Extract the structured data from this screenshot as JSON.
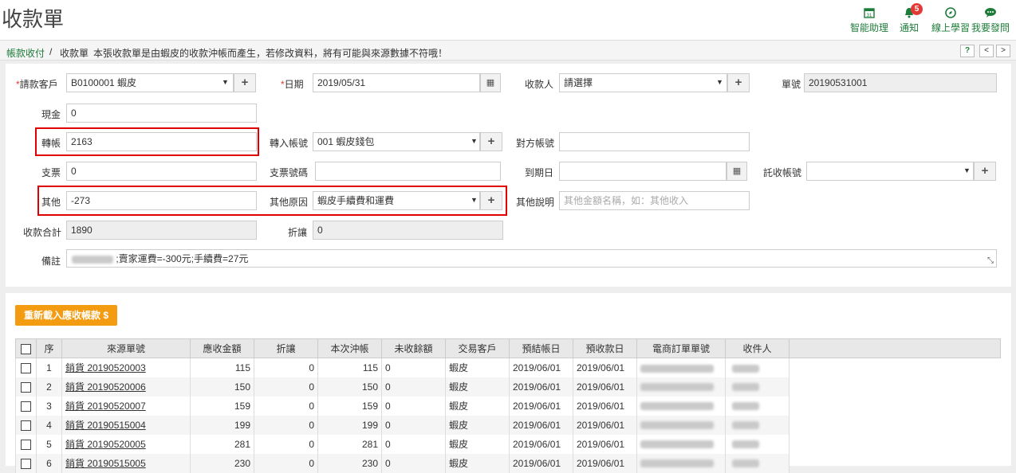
{
  "header": {
    "title": "收款單",
    "nav": [
      {
        "label": "智能助理",
        "icon": "calendar-icon"
      },
      {
        "label": "通知",
        "icon": "bell-icon",
        "badge": "5"
      },
      {
        "label": "線上學習",
        "icon": "compass-icon"
      },
      {
        "label": "我要發問",
        "icon": "chat-icon"
      }
    ]
  },
  "breadcrumb": {
    "parent": "帳款收付",
    "separator": "/",
    "current": "收款單",
    "note": "本張收款單是由蝦皮的收款沖帳而產生，若修改資料，將有可能與來源數據不符哦！",
    "help": "?",
    "prev": "<",
    "next": ">"
  },
  "form": {
    "customer_label": "請款客戶",
    "customer_value": "B0100001 蝦皮",
    "date_label": "日期",
    "date_value": "2019/05/31",
    "payee_label": "收款人",
    "payee_value": "請選擇",
    "doc_no_label": "單號",
    "doc_no_value": "20190531001",
    "cash_label": "現金",
    "cash_value": "0",
    "transfer_label": "轉帳",
    "transfer_value": "2163",
    "transfer_account_label": "轉入帳號",
    "transfer_account_value": "001 蝦皮錢包",
    "counter_account_label": "對方帳號",
    "counter_account_value": "",
    "check_label": "支票",
    "check_value": "0",
    "check_no_label": "支票號碼",
    "check_no_value": "",
    "due_date_label": "到期日",
    "due_date_value": "",
    "collect_account_label": "託收帳號",
    "collect_account_value": "",
    "other_label": "其他",
    "other_value": "-273",
    "other_reason_label": "其他原因",
    "other_reason_value": "蝦皮手續費和運費",
    "other_desc_label": "其他說明",
    "other_desc_placeholder": "其他金額名稱，如：其他收入",
    "total_label": "收款合計",
    "total_value": "1890",
    "discount_label": "折讓",
    "discount_value": "0",
    "memo_label": "備註",
    "memo_value": ";賣家運費=-300元;手續費=27元"
  },
  "reload_button": "重新載入應收帳款 $",
  "table": {
    "headers": [
      "序",
      "來源單號",
      "應收金額",
      "折讓",
      "本次沖帳",
      "未收餘額",
      "交易客戶",
      "預結帳日",
      "預收款日",
      "電商訂單單號",
      "收件人"
    ],
    "rows": [
      {
        "seq": "1",
        "source": "銷貨 20190520003",
        "receivable": "115",
        "discount": "0",
        "offset": "115",
        "balance": "0",
        "customer": "蝦皮",
        "settle_date": "2019/06/01",
        "receive_date": "2019/06/01"
      },
      {
        "seq": "2",
        "source": "銷貨 20190520006",
        "receivable": "150",
        "discount": "0",
        "offset": "150",
        "balance": "0",
        "customer": "蝦皮",
        "settle_date": "2019/06/01",
        "receive_date": "2019/06/01"
      },
      {
        "seq": "3",
        "source": "銷貨 20190520007",
        "receivable": "159",
        "discount": "0",
        "offset": "159",
        "balance": "0",
        "customer": "蝦皮",
        "settle_date": "2019/06/01",
        "receive_date": "2019/06/01"
      },
      {
        "seq": "4",
        "source": "銷貨 20190515004",
        "receivable": "199",
        "discount": "0",
        "offset": "199",
        "balance": "0",
        "customer": "蝦皮",
        "settle_date": "2019/06/01",
        "receive_date": "2019/06/01"
      },
      {
        "seq": "5",
        "source": "銷貨 20190520005",
        "receivable": "281",
        "discount": "0",
        "offset": "281",
        "balance": "0",
        "customer": "蝦皮",
        "settle_date": "2019/06/01",
        "receive_date": "2019/06/01"
      },
      {
        "seq": "6",
        "source": "銷貨 20190515005",
        "receivable": "230",
        "discount": "0",
        "offset": "230",
        "balance": "0",
        "customer": "蝦皮",
        "settle_date": "2019/06/01",
        "receive_date": "2019/06/01"
      }
    ]
  },
  "colors": {
    "accent": "#1e7c3a",
    "highlight": "#e00000",
    "button": "#f39c12"
  }
}
